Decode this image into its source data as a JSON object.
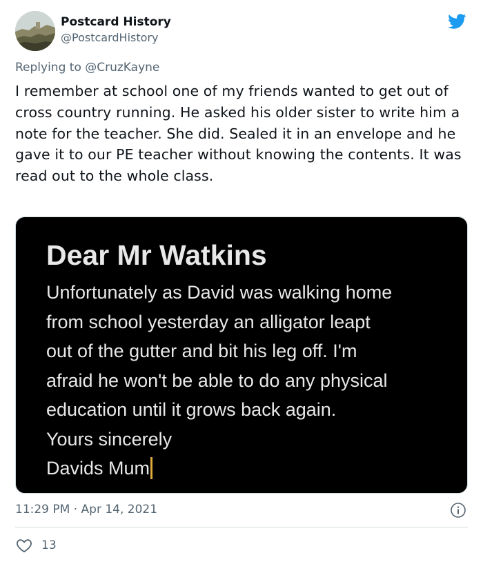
{
  "author": {
    "display_name": "Postcard History",
    "handle": "@PostcardHistory"
  },
  "reply": {
    "prefix": "Replying to ",
    "mention": "@CruzKayne"
  },
  "tweet_text": "I remember at school one of my friends wanted to get out of cross country running. He asked his older sister to write him a note for the teacher. She did. Sealed it in an envelope and he gave it to our PE teacher without knowing the contents. It was read out to the whole class.",
  "media": {
    "title": "Dear Mr Watkins",
    "lines": [
      "Unfortunately as David was walking home",
      "from school yesterday an alligator leapt",
      "out of the gutter and bit his leg off. I'm",
      "afraid he won't be able to do any physical",
      "education until it grows back again.",
      "Yours sincerely",
      "Davids Mum"
    ],
    "cursor_color": "#e0a93b"
  },
  "meta": {
    "timestamp": "11:29 PM · Apr 14, 2021"
  },
  "actions": {
    "like_count": "13"
  },
  "colors": {
    "brand_blue": "#1d9bf0",
    "secondary_text": "#536471",
    "primary_text": "#0f1419"
  },
  "icons": {
    "brand": "twitter-bird-icon",
    "info": "info-icon",
    "like": "heart-icon"
  }
}
